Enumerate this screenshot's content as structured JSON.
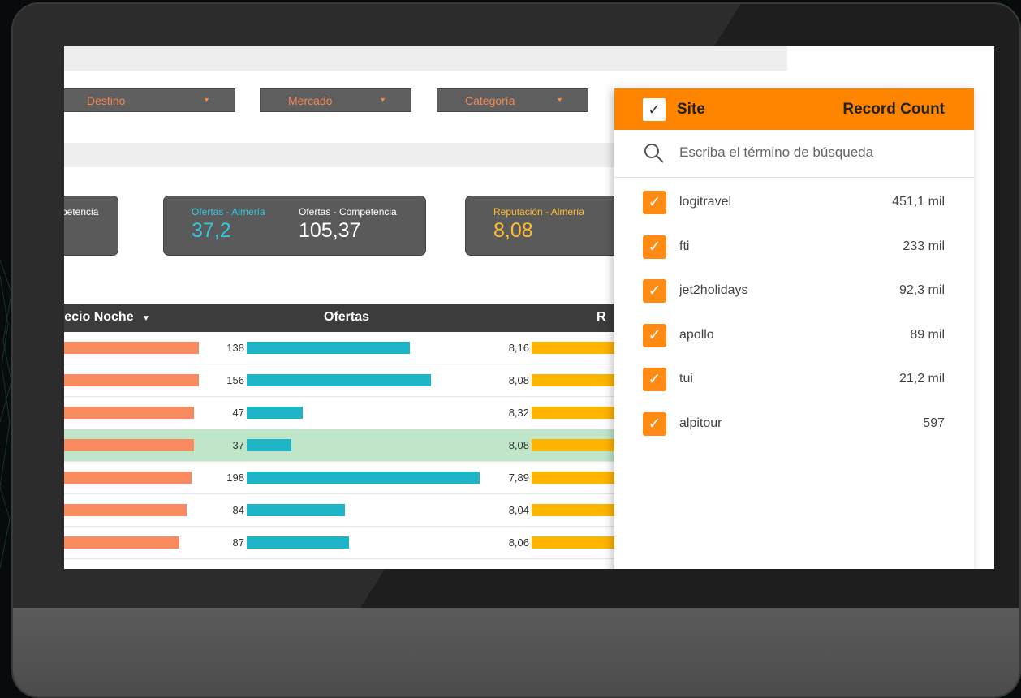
{
  "filters": [
    {
      "label": "Destino"
    },
    {
      "label": "Mercado"
    },
    {
      "label": "Categoría"
    }
  ],
  "kpis": [
    {
      "label1": "mpetencia",
      "value1": ""
    },
    {
      "label1": "Ofertas - Almería",
      "value1": "37,2",
      "label2": "Ofertas - Competencia",
      "value2": "105,37"
    },
    {
      "label1": "Reputación - Almería",
      "value1": "8,08"
    }
  ],
  "table": {
    "headers": {
      "precio": "recio Noche",
      "sort_arrow": "▼",
      "ofertas": "Ofertas",
      "third": "R"
    },
    "rows": [
      {
        "precio_fill": 0.59,
        "ofertas": "138",
        "ofertas_fill": 0.7,
        "rep": "8,16",
        "highlight": false
      },
      {
        "precio_fill": 0.59,
        "ofertas": "156",
        "ofertas_fill": 0.79,
        "rep": "8,08",
        "highlight": false
      },
      {
        "precio_fill": 0.57,
        "ofertas": "47",
        "ofertas_fill": 0.24,
        "rep": "8,32",
        "highlight": false
      },
      {
        "precio_fill": 0.57,
        "ofertas": "37",
        "ofertas_fill": 0.19,
        "rep": "8,08",
        "highlight": true
      },
      {
        "precio_fill": 0.56,
        "ofertas": "198",
        "ofertas_fill": 1.0,
        "rep": "7,89",
        "highlight": false
      },
      {
        "precio_fill": 0.54,
        "ofertas": "84",
        "ofertas_fill": 0.42,
        "rep": "8,04",
        "highlight": false
      },
      {
        "precio_fill": 0.51,
        "ofertas": "87",
        "ofertas_fill": 0.44,
        "rep": "8,06",
        "highlight": false
      }
    ]
  },
  "site_panel": {
    "site_header": "Site",
    "count_header": "Record Count",
    "check_glyph": "✓",
    "search_placeholder": "Escriba el término de búsqueda",
    "items": [
      {
        "name": "logitravel",
        "count": "451,1 mil",
        "checked": true
      },
      {
        "name": "fti",
        "count": "233 mil",
        "checked": true
      },
      {
        "name": "jet2holidays",
        "count": "92,3 mil",
        "checked": true
      },
      {
        "name": "apollo",
        "count": "89 mil",
        "checked": true
      },
      {
        "name": "tui",
        "count": "21,2 mil",
        "checked": true
      },
      {
        "name": "alpitour",
        "count": "597",
        "checked": true
      }
    ]
  },
  "colors": {
    "accent_orange": "#ff8400",
    "precio_bar": "#f78a5e",
    "ofertas_bar": "#1fb5c9",
    "rep_bar": "#ffb400",
    "kpi_cyan": "#35c3dd",
    "kpi_yellow": "#ffbd2e",
    "highlight_row": "#bfe6c9"
  }
}
